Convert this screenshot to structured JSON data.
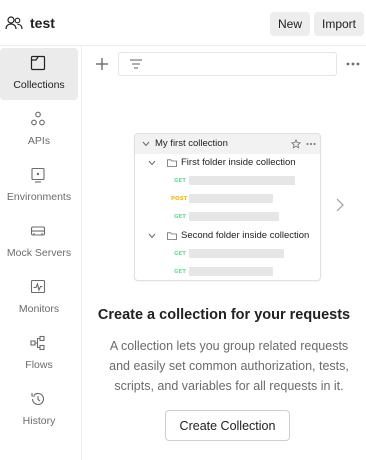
{
  "header": {
    "workspace_icon": "team-icon",
    "workspace_name": "test",
    "new_label": "New",
    "import_label": "Import"
  },
  "sidebar": {
    "items": [
      {
        "label": "Collections",
        "icon": "collections-icon",
        "active": true
      },
      {
        "label": "APIs",
        "icon": "apis-icon",
        "active": false
      },
      {
        "label": "Environments",
        "icon": "environments-icon",
        "active": false
      },
      {
        "label": "Mock Servers",
        "icon": "mock-servers-icon",
        "active": false
      },
      {
        "label": "Monitors",
        "icon": "monitors-icon",
        "active": false
      },
      {
        "label": "Flows",
        "icon": "flows-icon",
        "active": false
      },
      {
        "label": "History",
        "icon": "history-icon",
        "active": false
      }
    ]
  },
  "toolbar": {
    "add_icon": "plus-icon",
    "filter_icon": "filter-icon",
    "more_icon": "more-icon"
  },
  "illustration": {
    "collection_name": "My first collection",
    "folders": [
      {
        "name": "First folder inside collection",
        "requests": [
          "GET",
          "POST",
          "GET"
        ]
      },
      {
        "name": "Second folder inside collection",
        "requests": [
          "GET",
          "GET"
        ]
      }
    ],
    "colors": {
      "get": "#6bdd9a",
      "post": "#ffb400"
    }
  },
  "empty_state": {
    "title": "Create a collection for your requests",
    "description": "A collection lets you group related requests and easily set common authorization, tests, scripts, and variables for all requests in it.",
    "button_label": "Create Collection"
  }
}
